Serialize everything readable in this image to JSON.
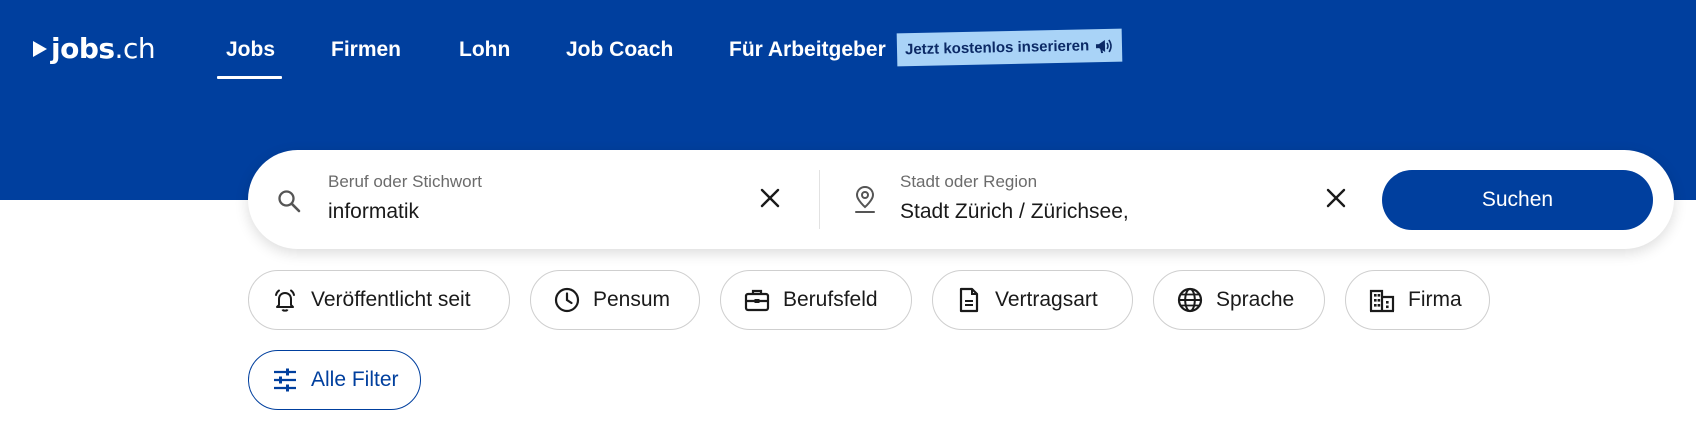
{
  "brand": {
    "logo_bold": "jobs",
    "logo_thin": ".ch"
  },
  "nav": {
    "items": [
      {
        "label": "Jobs",
        "active": true
      },
      {
        "label": "Firmen"
      },
      {
        "label": "Lohn"
      },
      {
        "label": "Job Coach"
      },
      {
        "label": "Für Arbeitgeber"
      }
    ],
    "promo_badge": "Jetzt kostenlos inserieren"
  },
  "search": {
    "keyword_label": "Beruf oder Stichwort",
    "keyword_value": "informatik",
    "location_label": "Stadt oder Region",
    "location_value": "Stadt Zürich / Zürichsee,",
    "submit_label": "Suchen"
  },
  "filters": {
    "chips": [
      {
        "label": "Veröffentlicht seit",
        "icon": "bell-icon"
      },
      {
        "label": "Pensum",
        "icon": "clock-icon"
      },
      {
        "label": "Berufsfeld",
        "icon": "briefcase-icon"
      },
      {
        "label": "Vertragsart",
        "icon": "document-icon"
      },
      {
        "label": "Sprache",
        "icon": "globe-icon"
      },
      {
        "label": "Firma",
        "icon": "building-icon"
      }
    ],
    "all_filters_label": "Alle Filter"
  },
  "colors": {
    "brand_blue": "#003f9e",
    "badge_bg": "#a9d3f7",
    "badge_text": "#0c2a66",
    "chip_border": "#cfcfcf",
    "text_dark": "#1a1a1a",
    "label_gray": "#6b6b6b"
  }
}
